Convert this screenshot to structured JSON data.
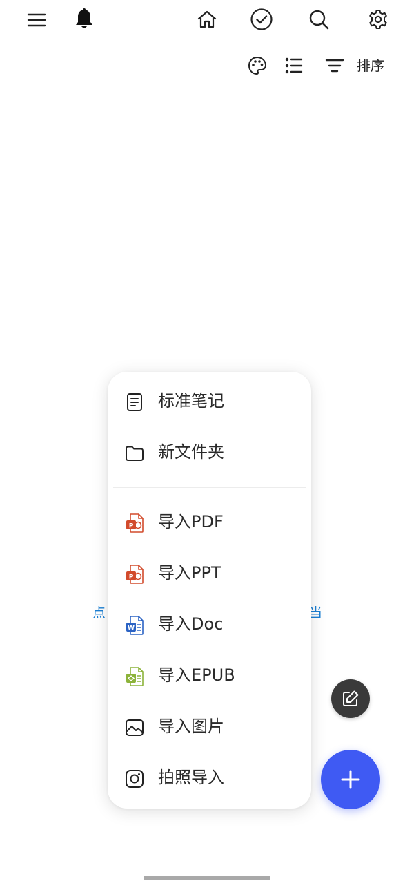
{
  "topbar": {
    "icons": [
      "menu-icon",
      "bell-icon",
      "home-icon",
      "check-circle-icon",
      "search-icon",
      "gear-icon"
    ]
  },
  "toolbar": {
    "icons": [
      "palette-icon",
      "list-icon",
      "filter-icon"
    ],
    "sort_label": "排序"
  },
  "empty_hint": {
    "left_fragment": "点",
    "right_fragment": "当"
  },
  "menu": {
    "items": [
      {
        "label": "标准笔记",
        "icon": "document-icon"
      },
      {
        "label": "新文件夹",
        "icon": "folder-icon"
      },
      {
        "label": "导入PDF",
        "icon": "pdf-file-icon"
      },
      {
        "label": "导入PPT",
        "icon": "ppt-file-icon"
      },
      {
        "label": "导入Doc",
        "icon": "word-file-icon"
      },
      {
        "label": "导入EPUB",
        "icon": "epub-file-icon"
      },
      {
        "label": "导入图片",
        "icon": "image-icon"
      },
      {
        "label": "拍照导入",
        "icon": "camera-icon"
      }
    ]
  },
  "colors": {
    "fab_add": "#3f5af3",
    "fab_edit": "#3a3a3a",
    "hint_link": "#1a7fd4",
    "pdf_ppt_red": "#d24b2c",
    "word_blue": "#2b63c4",
    "epub_green": "#8cb33a"
  }
}
